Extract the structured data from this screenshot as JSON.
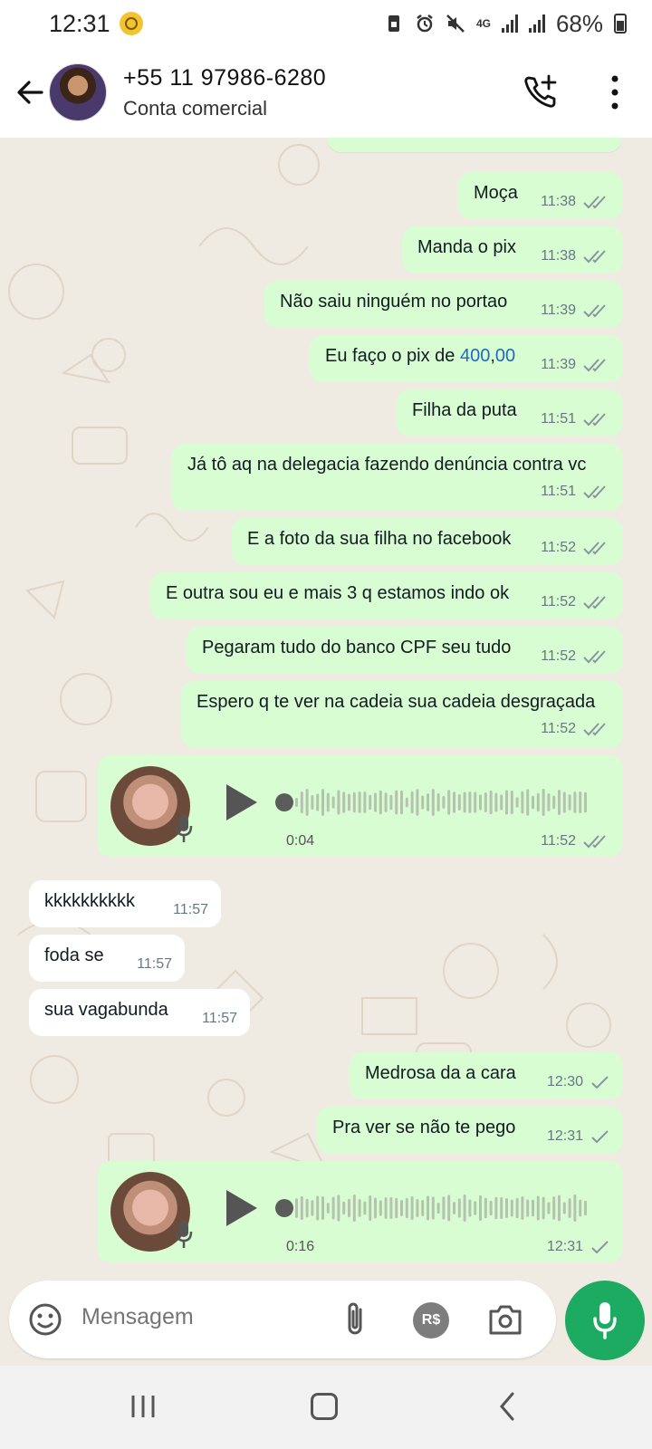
{
  "status_bar": {
    "time": "12:31",
    "network": "4G",
    "battery": "68%"
  },
  "header": {
    "contact_name": "+55 11 97986-6280",
    "contact_subtitle": "Conta comercial"
  },
  "messages": [
    {
      "dir": "out",
      "text": "Moça",
      "time": "11:38",
      "ticks": "double"
    },
    {
      "dir": "out",
      "text": "Manda o pix",
      "time": "11:38",
      "ticks": "double"
    },
    {
      "dir": "out",
      "text": "Não saiu ninguém no portao",
      "time": "11:39",
      "ticks": "double"
    },
    {
      "dir": "out",
      "text_before": "Eu faço o pix de ",
      "amount_int": "400",
      "amount_sep": ",",
      "amount_dec": "00",
      "time": "11:39",
      "ticks": "double"
    },
    {
      "dir": "out",
      "text": "Filha da puta",
      "time": "11:51",
      "ticks": "double"
    },
    {
      "dir": "out",
      "text": "Já tô aq na delegacia fazendo denúncia contra vc",
      "time": "11:51",
      "ticks": "double"
    },
    {
      "dir": "out",
      "text": "E a foto da sua filha no facebook",
      "time": "11:52",
      "ticks": "double"
    },
    {
      "dir": "out",
      "text": "E outra sou eu e mais 3 q estamos indo ok",
      "time": "11:52",
      "ticks": "double"
    },
    {
      "dir": "out",
      "text": "Pegaram tudo do banco CPF seu tudo",
      "time": "11:52",
      "ticks": "double"
    },
    {
      "dir": "out",
      "text": "Espero q te ver na cadeia sua cadeia desgraçada",
      "time": "11:52",
      "ticks": "double"
    },
    {
      "dir": "out",
      "type": "voice",
      "duration": "0:04",
      "time": "11:52",
      "ticks": "double",
      "progress": 0
    },
    {
      "dir": "in",
      "text": "kkkkkkkkkk",
      "time": "11:57"
    },
    {
      "dir": "in",
      "text": "foda se",
      "time": "11:57"
    },
    {
      "dir": "in",
      "text": "sua vagabunda",
      "time": "11:57"
    },
    {
      "dir": "out",
      "text": "Medrosa da a cara",
      "time": "12:30",
      "ticks": "single"
    },
    {
      "dir": "out",
      "text": "Pra ver se não te pego",
      "time": "12:31",
      "ticks": "single"
    },
    {
      "dir": "out",
      "type": "voice",
      "duration": "0:16",
      "time": "12:31",
      "ticks": "single",
      "progress": 0
    }
  ],
  "input_bar": {
    "placeholder": "Mensagem",
    "currency_label": "R$"
  },
  "icons": {
    "back": "arrow-left-icon",
    "call": "add-call-icon",
    "menu": "more-vert-icon",
    "emoji": "emoji-icon",
    "attach": "paperclip-icon",
    "camera": "camera-icon",
    "mic": "mic-icon"
  },
  "colors": {
    "outgoing_bubble": "#d9fdd3",
    "incoming_bubble": "#ffffff",
    "chat_bg": "#efeae2",
    "accent": "#1daa61",
    "read_ticks": "#8696a0",
    "link_amount": "#1c6bbf"
  }
}
